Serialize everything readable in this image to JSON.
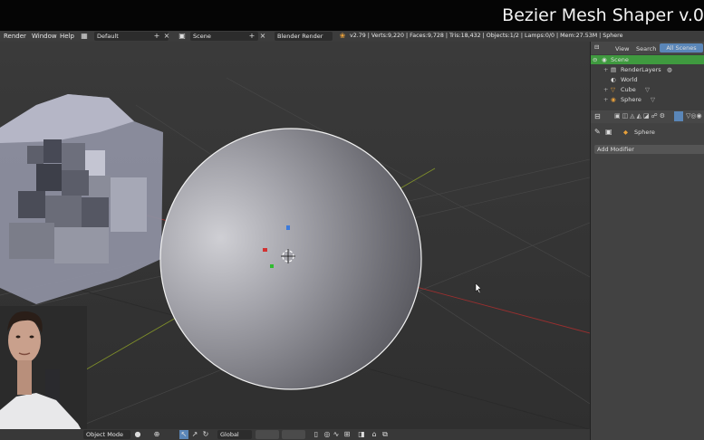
{
  "title": "Bezier Mesh Shaper v.0",
  "menu": {
    "render": "Render",
    "window": "Window",
    "help": "Help"
  },
  "layout_field": "Default",
  "scene_field": "Scene",
  "engine_field": "Blender Render",
  "stats": "v2.79 | Verts:9,220 | Faces:9,728 | Tris:18,432 | Objects:1/2 | Lamps:0/0 | Mem:27.53M | Sphere",
  "outliner": {
    "tabs": {
      "view": "View",
      "search": "Search",
      "all_scenes": "All Scenes"
    },
    "items": {
      "scene": "Scene",
      "renderlayers": "RenderLayers",
      "world": "World",
      "cube": "Cube",
      "sphere": "Sphere"
    }
  },
  "properties": {
    "object_name": "Sphere",
    "add_modifier": "Add Modifier"
  },
  "bottom": {
    "mode": "Object Mode",
    "orientation": "Global"
  },
  "colors": {
    "scene_highlight": "#3f9a3f",
    "viewport_bg": "#393939",
    "x_axis": "#9b2f2f",
    "y_axis": "#7f8f2a"
  }
}
